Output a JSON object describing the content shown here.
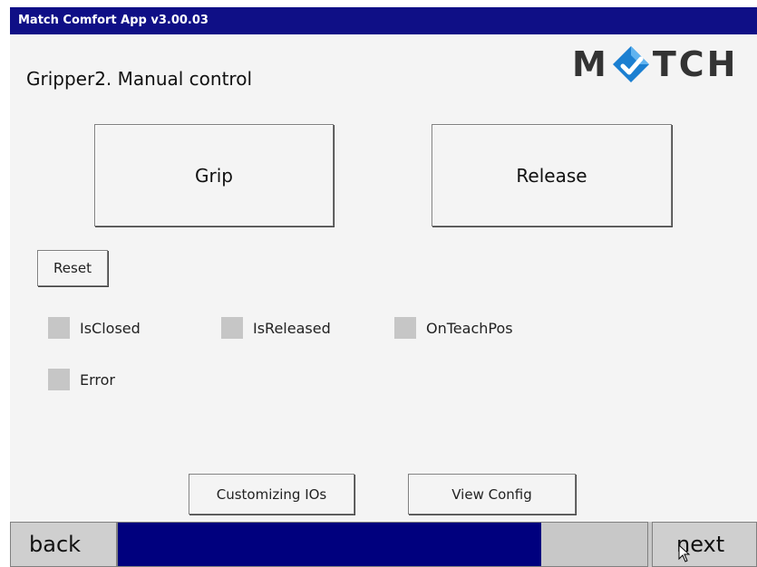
{
  "window": {
    "title": "Match Comfort App v3.00.03"
  },
  "header": {
    "title": "Gripper2. Manual control",
    "logo_left": "M",
    "logo_right": "TCH"
  },
  "actions": {
    "grip_label": "Grip",
    "release_label": "Release",
    "reset_label": "Reset"
  },
  "indicators": [
    {
      "label": "IsClosed",
      "active": false
    },
    {
      "label": "IsReleased",
      "active": false
    },
    {
      "label": "OnTeachPos",
      "active": false
    },
    {
      "label": "Error",
      "active": false
    }
  ],
  "footer_buttons": {
    "customizing_label": "Customizing IOs",
    "view_config_label": "View Config"
  },
  "nav": {
    "back_label": "back",
    "next_label": "next",
    "progress_fraction": 0.8
  },
  "colors": {
    "titlebar": "#0f0f86",
    "progress_fill": "#00007e",
    "logo_blue": "#1b7fd1",
    "indicator_off": "#c6c6c6"
  },
  "icons": [
    "match-logo-diamond-icon",
    "mouse-cursor-icon"
  ]
}
